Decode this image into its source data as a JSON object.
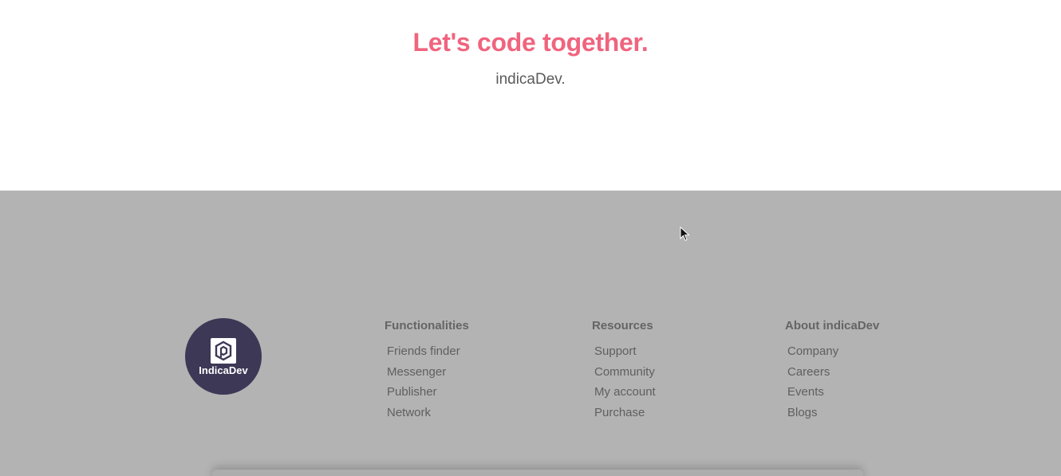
{
  "hero": {
    "title": "Let's code together.",
    "subtitle": "indicaDev."
  },
  "footer": {
    "logo_text": "IndicaDev",
    "columns": [
      {
        "title": "Functionalities",
        "links": [
          "Friends finder",
          "Messenger",
          "Publisher",
          "Network"
        ]
      },
      {
        "title": "Resources",
        "links": [
          "Support",
          "Community",
          "My account",
          "Purchase"
        ]
      },
      {
        "title": "About indicaDev",
        "links": [
          "Company",
          "Careers",
          "Events",
          "Blogs"
        ]
      }
    ]
  },
  "colors": {
    "accent": "#f0647e",
    "footer_bg": "#b3b3b3",
    "logo_bg": "#3d3856"
  },
  "icons": {
    "logo": "indicadev-hexagon-logo-icon",
    "cursor": "mouse-pointer-icon"
  }
}
